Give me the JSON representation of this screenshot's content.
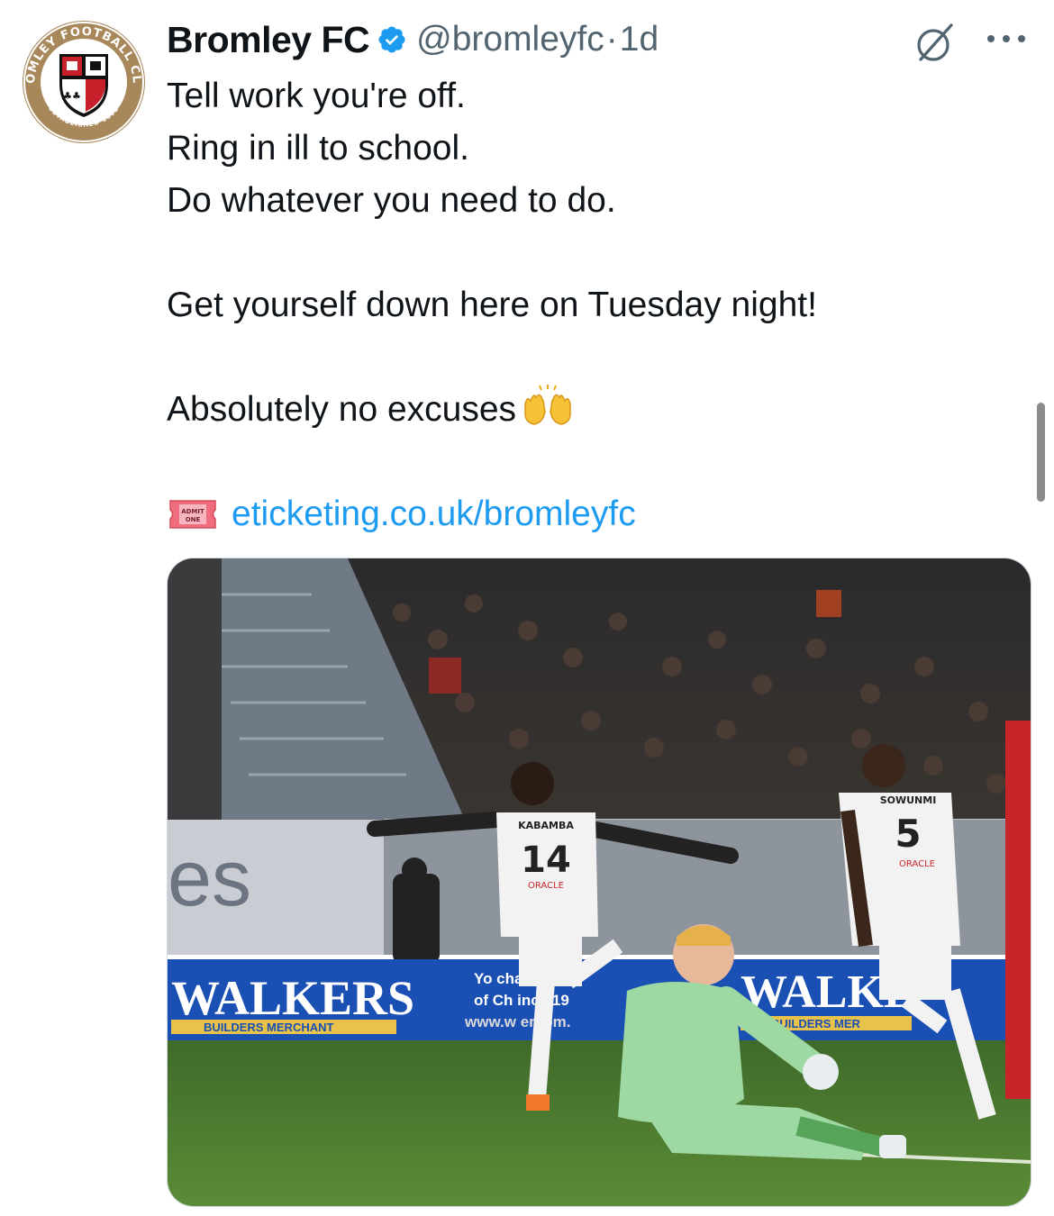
{
  "author": {
    "display_name": "Bromley FC",
    "handle": "@bromleyfc",
    "separator": "·",
    "timestamp": "1d",
    "verified": true,
    "avatar": {
      "icon": "club-crest-avatar",
      "crest_text_top": "BROMLEY FOOTBALL CLUB",
      "crest_text_bottom": "ESTABLISHED 1892"
    }
  },
  "tweet": {
    "lines": [
      "Tell work you're off.",
      "Ring in ill to school.",
      "Do whatever you need to do.",
      "",
      "Get yourself down here on Tuesday night!",
      "",
      "Absolutely no excuses"
    ],
    "emoji": "raising-hands-emoji",
    "link_icon": "admission-ticket-emoji",
    "ticket_text": "ADMIT ONE",
    "link_text": "eticketing.co.uk/bromleyfc"
  },
  "media": {
    "type": "photo",
    "description_icon": "football-celebration-photo",
    "board_text_left": "WALKERS",
    "board_sub_left": "BUILDERS MERCHANT",
    "board_text_right": "WALKE",
    "board_sub_right": "BUILDERS MER",
    "board_mid_line1": "Yo        chant",
    "board_mid_line2": "of Ch      ince 19",
    "board_mid_line3": "www.w    ersbm.",
    "player1_name": "KABAMBA",
    "player1_number": "14",
    "player2_name": "SOWUNMI",
    "player2_number": "5",
    "sponsor": "ORACLE",
    "wall_text": "es"
  },
  "actions": {
    "grok_icon": "grok-icon",
    "more_icon": "more-icon"
  },
  "colors": {
    "link": "#1d9bf0",
    "secondary": "#536471",
    "verified": "#1d9bf0",
    "board_blue": "#1a4fb4"
  }
}
